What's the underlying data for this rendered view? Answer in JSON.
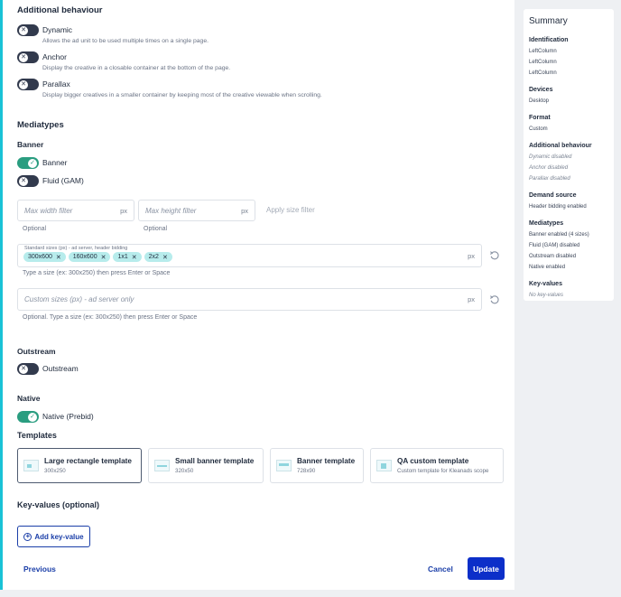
{
  "behaviour": {
    "title": "Additional behaviour",
    "items": [
      {
        "label": "Dynamic",
        "desc": "Allows the ad unit to be used multiple times on a single page.",
        "on": false
      },
      {
        "label": "Anchor",
        "desc": "Display the creative in a closable container at the bottom of the page.",
        "on": false
      },
      {
        "label": "Parallax",
        "desc": "Display bigger creatives in a smaller container by keeping most of the creative viewable when scrolling.",
        "on": false
      }
    ]
  },
  "mediatypes": {
    "title": "Mediatypes",
    "banner": {
      "subtitle": "Banner",
      "toggles": [
        {
          "label": "Banner",
          "on": true
        },
        {
          "label": "Fluid (GAM)",
          "on": false
        }
      ],
      "max_width": {
        "placeholder": "Max width filter",
        "unit": "px",
        "hint": "Optional"
      },
      "max_height": {
        "placeholder": "Max height filter",
        "unit": "px",
        "hint": "Optional"
      },
      "apply_label": "Apply size filter",
      "standard_sizes": {
        "label": "Standard sizes (px) - ad server, header bidding",
        "chips": [
          "300x600",
          "160x600",
          "1x1",
          "2x2"
        ],
        "unit": "px",
        "hint": "Type a size (ex: 300x250) then press Enter or Space"
      },
      "custom_sizes": {
        "placeholder": "Custom sizes (px) - ad server only",
        "unit": "px",
        "hint": "Optional. Type a size (ex: 300x250) then press Enter or Space"
      }
    },
    "outstream": {
      "subtitle": "Outstream",
      "toggle": {
        "label": "Outstream",
        "on": false
      }
    },
    "native": {
      "subtitle": "Native",
      "toggle": {
        "label": "Native (Prebid)",
        "on": true
      }
    }
  },
  "templates": {
    "title": "Templates",
    "items": [
      {
        "name": "Large rectangle template",
        "sub": "300x250",
        "selected": true
      },
      {
        "name": "Small banner template",
        "sub": "320x50",
        "selected": false
      },
      {
        "name": "Banner template",
        "sub": "728x90",
        "selected": false
      },
      {
        "name": "QA custom template",
        "sub": "Custom template for Kleanads scope",
        "selected": false
      }
    ]
  },
  "keyvalues": {
    "title": "Key-values (optional)",
    "add_label": "Add key-value"
  },
  "footer": {
    "previous": "Previous",
    "cancel": "Cancel",
    "update": "Update"
  },
  "summary": {
    "title": "Summary",
    "groups": [
      {
        "heading": "Identification",
        "lines": [
          "LeftColumn",
          "LeftColumn",
          "LeftColumn"
        ]
      },
      {
        "heading": "Devices",
        "lines": [
          "Desktop"
        ]
      },
      {
        "heading": "Format",
        "lines": [
          "Custom"
        ]
      },
      {
        "heading": "Additional behaviour",
        "lines": [
          "Dynamic disabled",
          "Anchor disabled",
          "Parallax disabled"
        ],
        "muted": true
      },
      {
        "heading": "Demand source",
        "lines": [
          "Header bidding enabled"
        ]
      },
      {
        "heading": "Mediatypes",
        "lines": [
          "Banner enabled (4 sizes)",
          "Fluid (GAM) disabled",
          "Outstream disabled",
          "Native enabled"
        ]
      },
      {
        "heading": "Key-values",
        "lines": [
          "No key-values"
        ],
        "muted": true
      }
    ]
  },
  "colors": {
    "accent": "#19c2d6",
    "toggle_on": "#2a9d80",
    "toggle_off": "#323a4d",
    "primary": "#0c2fc9",
    "chip": "#b7ecec"
  }
}
